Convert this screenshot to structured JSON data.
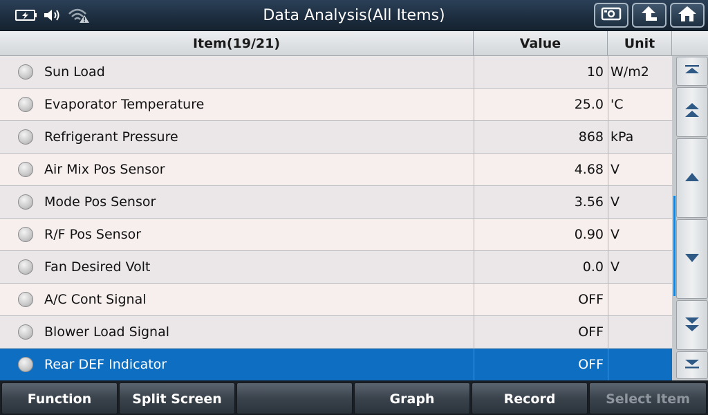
{
  "header": {
    "title": "Data Analysis(All Items)",
    "buttons": [
      "screenshot-icon",
      "back-icon",
      "home-icon"
    ]
  },
  "table": {
    "columns": {
      "item": "Item(19/21)",
      "value": "Value",
      "unit": "Unit"
    },
    "rows": [
      {
        "name": "Sun Load",
        "value": "10",
        "unit": "W/m2"
      },
      {
        "name": "Evaporator Temperature",
        "value": "25.0",
        "unit": "'C"
      },
      {
        "name": "Refrigerant Pressure",
        "value": "868",
        "unit": "kPa"
      },
      {
        "name": "Air Mix Pos Sensor",
        "value": "4.68",
        "unit": "V"
      },
      {
        "name": "Mode Pos Sensor",
        "value": "3.56",
        "unit": "V"
      },
      {
        "name": "R/F Pos Sensor",
        "value": "0.90",
        "unit": "V"
      },
      {
        "name": "Fan Desired Volt",
        "value": "0.0",
        "unit": "V"
      },
      {
        "name": "A/C Cont Signal",
        "value": "OFF",
        "unit": ""
      },
      {
        "name": "Blower Load Signal",
        "value": "OFF",
        "unit": ""
      },
      {
        "name": "Rear DEF Indicator",
        "value": "OFF",
        "unit": "",
        "selected": true
      }
    ]
  },
  "footer": {
    "function": "Function",
    "split_screen": "Split Screen",
    "empty": "",
    "graph": "Graph",
    "record": "Record",
    "select_item": "Select Item"
  },
  "colors": {
    "selected_row": "#0e6fc2",
    "scroll_thumb": "#1a82d6"
  }
}
